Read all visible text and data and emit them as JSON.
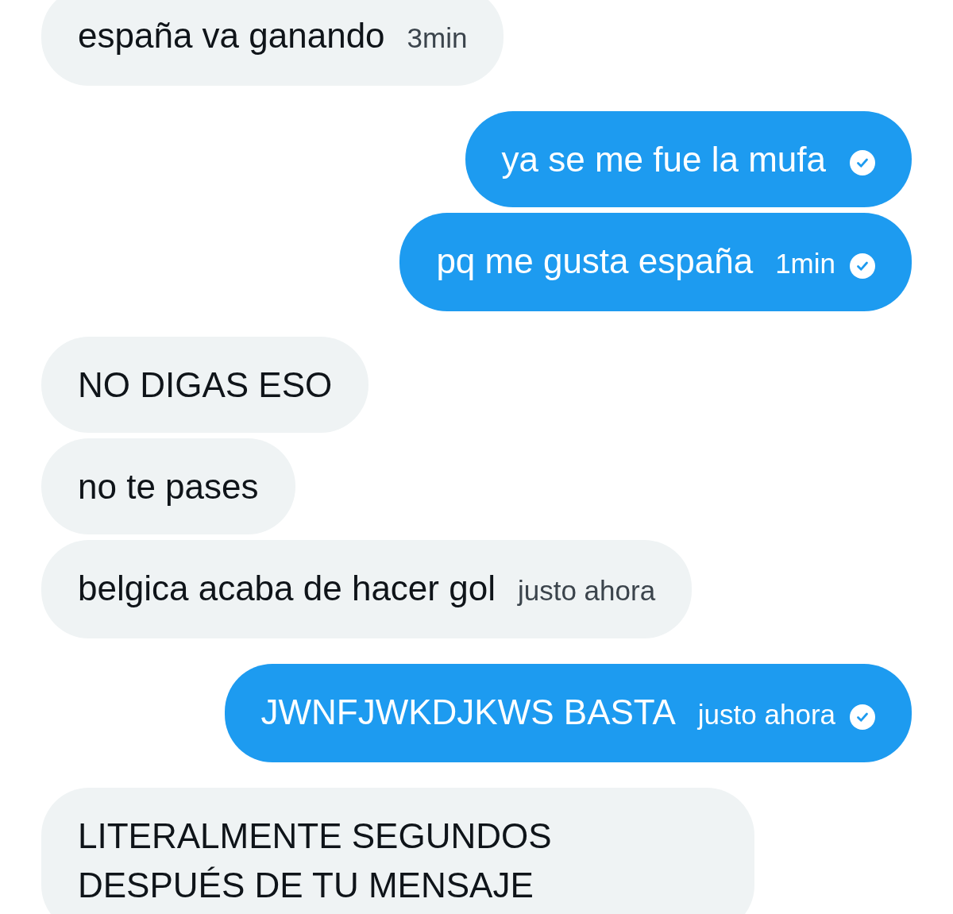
{
  "messages": [
    {
      "kind": "received",
      "text": "españa va ganando",
      "time": "3min"
    },
    {
      "kind": "sent",
      "text": "ya se me fue la mufa",
      "delivered": true
    },
    {
      "kind": "sent",
      "text": "pq me gusta españa",
      "time": "1min",
      "delivered": true
    },
    {
      "kind": "received",
      "text": "NO DIGAS ESO"
    },
    {
      "kind": "received",
      "text": "no te pases"
    },
    {
      "kind": "received",
      "text": "belgica acaba de hacer gol",
      "time": "justo ahora"
    },
    {
      "kind": "sent",
      "text": "JWNFJWKDJKWS BASTA",
      "time": "justo ahora",
      "delivered": true
    },
    {
      "kind": "received",
      "text": "LITERALMENTE SEGUNDOS DESPUÉS DE TU MENSAJE"
    }
  ]
}
